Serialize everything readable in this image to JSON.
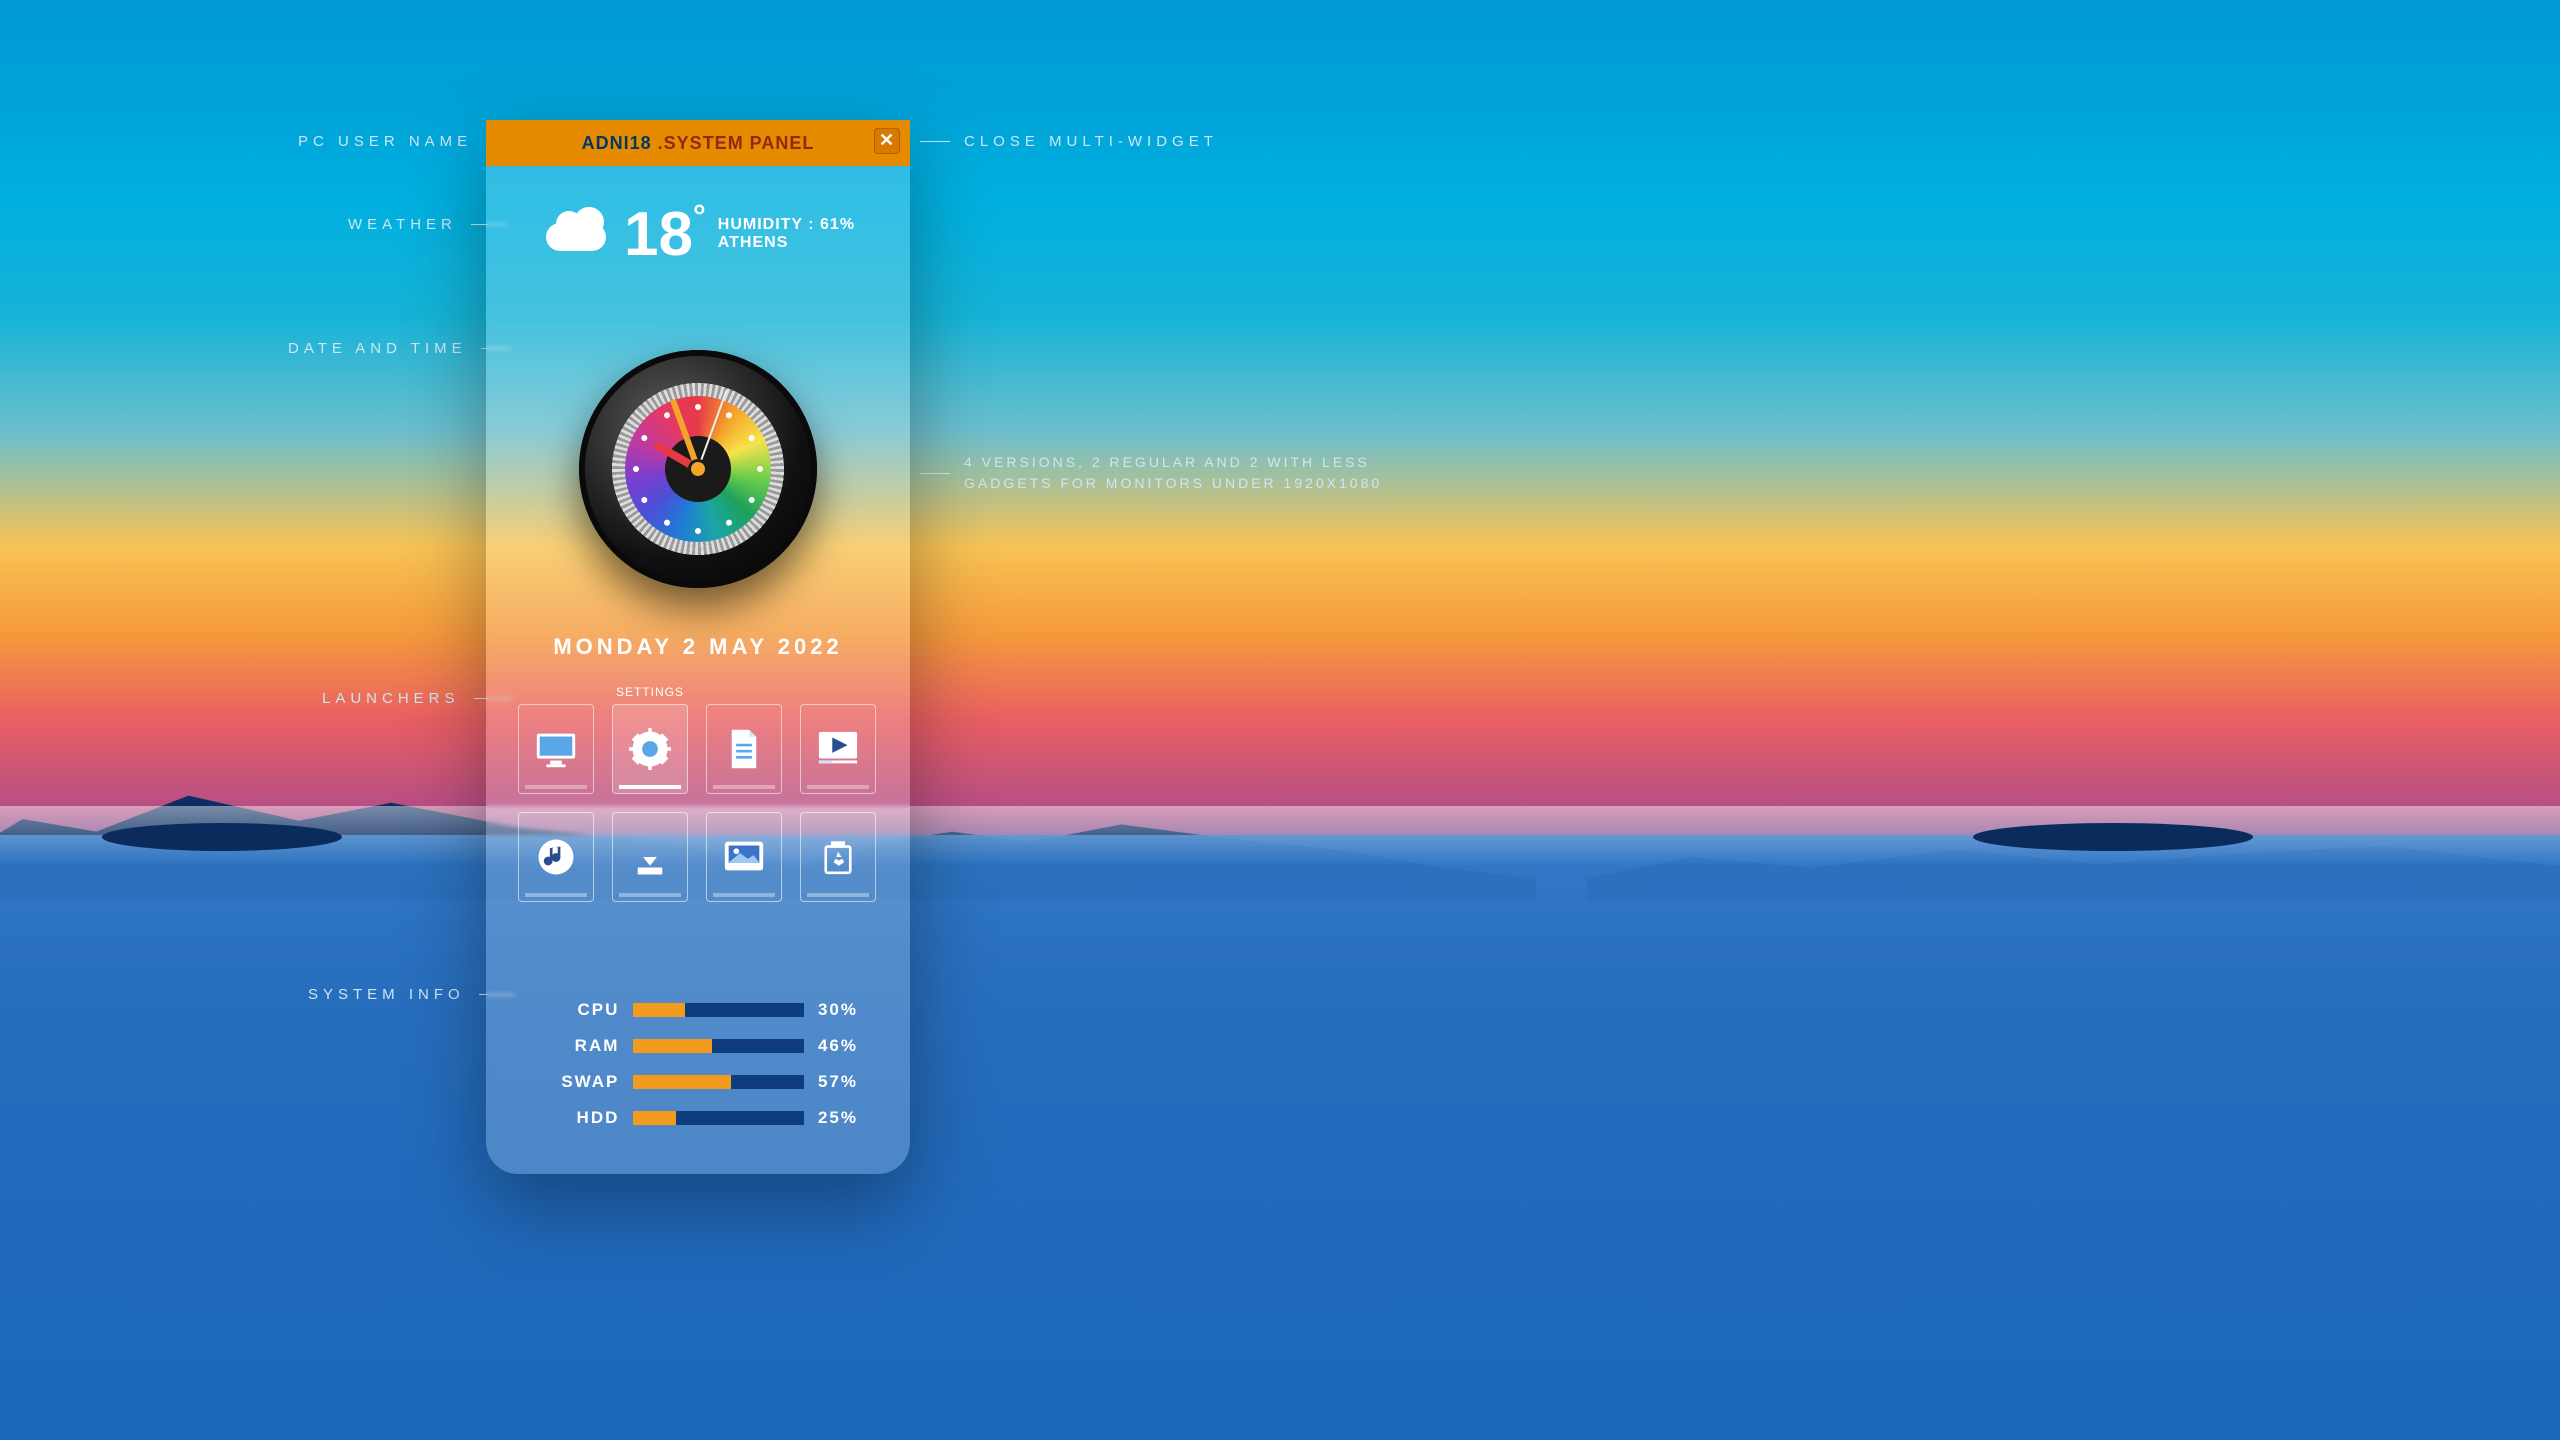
{
  "callouts": {
    "pc_user": "PC USER NAME",
    "weather": "WEATHER",
    "datetime": "DATE AND TIME",
    "launchers": "LAUNCHERS",
    "sysinfo": "SYSTEM INFO",
    "close": "CLOSE MULTI-WIDGET",
    "versions": "4 VERSIONS, 2 REGULAR AND 2 WITH LESS GADGETS FOR MONITORS UNDER 1920X1080"
  },
  "title": {
    "user": "ADNI18",
    "dot": ".",
    "label": "SYSTEM PANEL"
  },
  "weather": {
    "temp": "18",
    "deg": "°",
    "humidity": "HUMIDITY : 61%",
    "city": "ATHENS"
  },
  "date": "MONDAY 2 MAY 2022",
  "launchers": {
    "tooltip": "SETTINGS",
    "items": [
      "computer",
      "settings",
      "documents",
      "videos",
      "music",
      "downloads",
      "pictures",
      "recycle"
    ]
  },
  "system": {
    "rows": [
      {
        "label": "CPU",
        "pct": 30
      },
      {
        "label": "RAM",
        "pct": 46
      },
      {
        "label": "SWAP",
        "pct": 57
      },
      {
        "label": "HDD",
        "pct": 25
      }
    ]
  }
}
